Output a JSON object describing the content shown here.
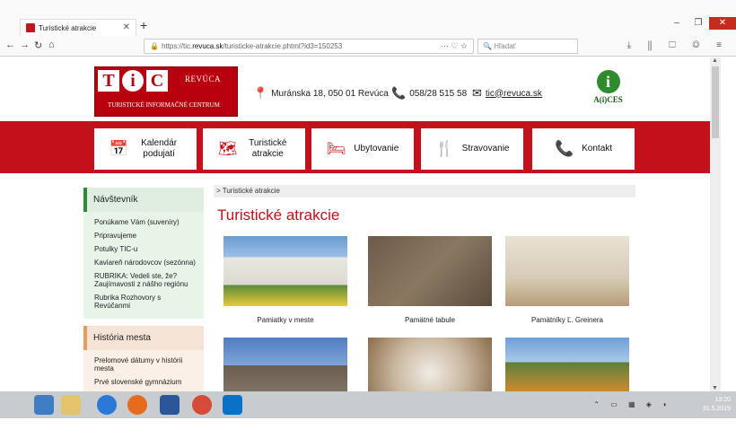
{
  "browser": {
    "tab_title": "Turistické atrakcie",
    "url_prefix": "https://tic.",
    "url_domain": "revuca.sk",
    "url_path": "/turisticke-atrakcie.phtml?id3=150253",
    "search_placeholder": "Hľadať"
  },
  "header": {
    "logo_letters": [
      "T",
      "i",
      "C"
    ],
    "logo_town": "REVÚCA",
    "logo_sub": "TURISTICKÉ INFORMAČNÉ CENTRUM",
    "address": "Muránska 18, 050 01 Revúca",
    "phone": "058/28 515 58",
    "email": "tic@revuca.sk",
    "aices_letter": "i",
    "aices_text": "A(i)CES"
  },
  "menu": [
    {
      "label": "Kalendár podujatí",
      "icon": "calendar-icon"
    },
    {
      "label": "Turistické atrakcie",
      "icon": "map-pin-icon"
    },
    {
      "label": "Ubytovanie",
      "icon": "bed-icon"
    },
    {
      "label": "Stravovanie",
      "icon": "cutlery-icon"
    },
    {
      "label": "Kontakt",
      "icon": "phone-icon"
    }
  ],
  "sidebar": {
    "section1_title": "Návštevník",
    "section1_items": [
      "Ponúkame Vám (suveníry)",
      "Pripravujeme",
      "Potulky TIC-u",
      "Kaviareň národovcov (sezónna)",
      "RUBRIKA: Vedeli ste, že? Zaujímavosti z nášho regiónu",
      "Rubrika Rozhovory s Revúčanmi"
    ],
    "section2_title": "História mesta",
    "section2_items": [
      "Prelomové dátumy v histórii mesta",
      "Prvé slovenské gymnázium"
    ]
  },
  "main": {
    "breadcrumb": "> Turistické atrakcie",
    "title": "Turistické atrakcie",
    "cards": [
      {
        "caption": "Pamiatky v meste"
      },
      {
        "caption": "Pamätné tabule"
      },
      {
        "caption": "Pamätníky Ľ. Greinera"
      },
      {
        "caption": ""
      },
      {
        "caption": ""
      },
      {
        "caption": ""
      }
    ]
  },
  "taskbar": {
    "time": "13:20",
    "date": "31.5.2019"
  }
}
